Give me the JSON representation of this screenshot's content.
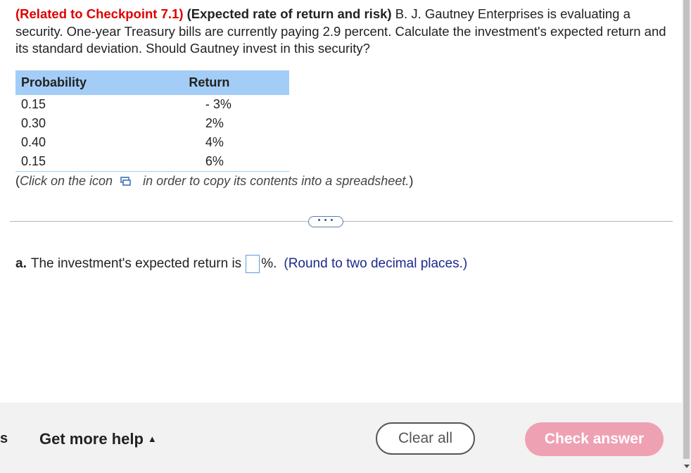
{
  "question": {
    "ref": "(Related to Checkpoint 7.1)",
    "topic": "(Expected rate of return and risk)",
    "text": "B. J. Gautney Enterprises is evaluating a security.  One-year Treasury bills are currently paying 2.9 percent.  Calculate the investment's expected return and its standard deviation.  Should Gautney invest in this security?"
  },
  "table": {
    "headers": [
      "Probability",
      "Return"
    ],
    "rows": [
      {
        "probability": "0.15",
        "return": "- 3%"
      },
      {
        "probability": "0.30",
        "return": "2%"
      },
      {
        "probability": "0.40",
        "return": "4%"
      },
      {
        "probability": "0.15",
        "return": "6%"
      }
    ]
  },
  "copy_note": {
    "open": "(",
    "before": "Click on the icon",
    "after": "in order to copy its contents into a spreadsheet.",
    "close": ")",
    "icon": "copy-table-icon"
  },
  "expand_label": "• • •",
  "answer": {
    "part": "a.",
    "text": "The investment's expected return is",
    "value": "",
    "suffix": "%.",
    "hint": "(Round to two decimal places.)"
  },
  "footer": {
    "edge_char": "s",
    "help_label": "Get more help",
    "help_caret": "▲",
    "clear_label": "Clear all",
    "check_label": "Check answer"
  },
  "colors": {
    "ref_red": "#e00000",
    "table_header": "#a3cdf6",
    "hint_navy": "#1c2a8a",
    "check_button": "#efa1b4"
  }
}
